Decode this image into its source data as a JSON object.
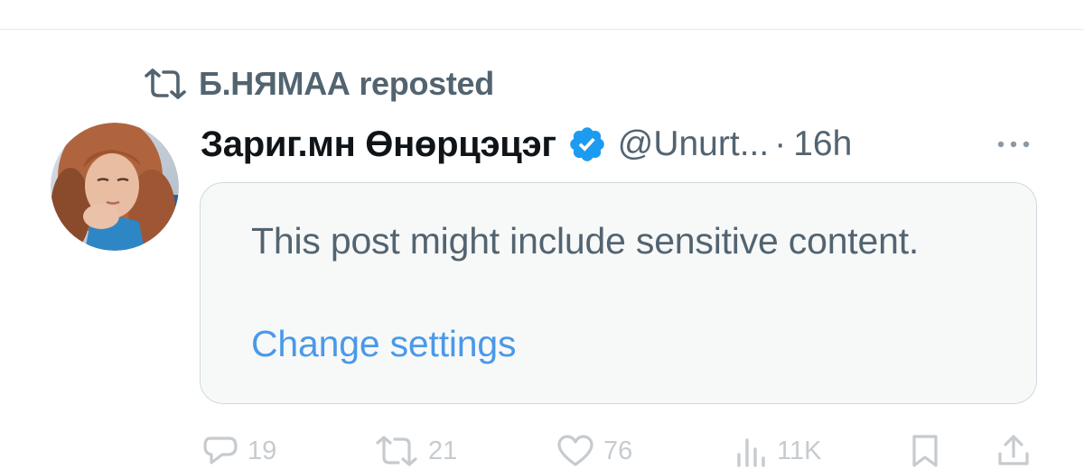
{
  "repost": {
    "icon": "repost-icon",
    "text": "Б.НЯМАА reposted"
  },
  "post": {
    "avatar_icon": "user-avatar",
    "display_name": "Зариг.мн Өнөрцэцэг",
    "verified_icon": "verified-badge-icon",
    "verified_color": "#1d9bf0",
    "handle": "@Unurt...",
    "separator": "·",
    "time": "16h",
    "more_icon": "more-icon",
    "sensitive_notice": {
      "message": "This post might include sensitive content.",
      "link": "Change settings",
      "link_color": "#4a99e9"
    }
  },
  "actions": {
    "reply": {
      "icon": "reply-icon",
      "count": "19"
    },
    "repost": {
      "icon": "repost-icon",
      "count": "21"
    },
    "like": {
      "icon": "like-icon",
      "count": "76"
    },
    "views": {
      "icon": "views-icon",
      "count": "11K"
    },
    "bookmark": {
      "icon": "bookmark-icon"
    },
    "share": {
      "icon": "share-icon"
    }
  }
}
